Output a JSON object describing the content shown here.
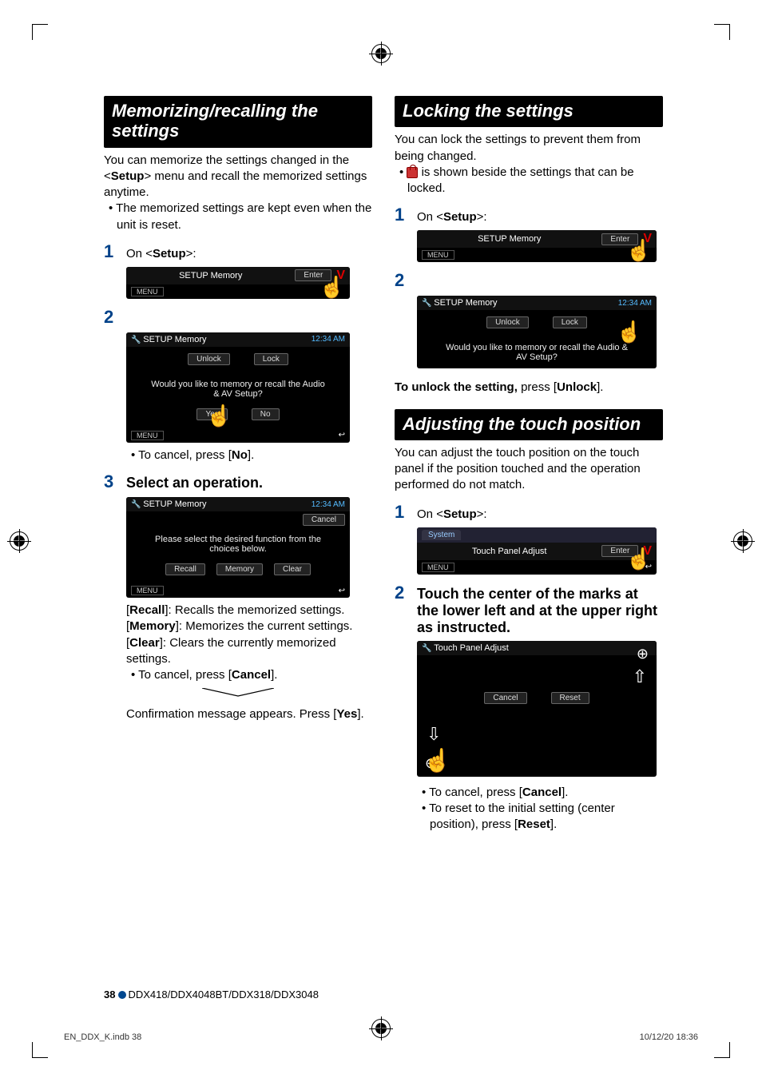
{
  "left": {
    "heading": "Memorizing/recalling the settings",
    "intro_a": "You can memorize the settings changed in the ",
    "setup_word": "Setup",
    "intro_b": " menu and recall the memorized settings anytime.",
    "bullet": "The memorized settings are kept even when the unit is reset.",
    "colon": ":",
    "period": ".",
    "step1": {
      "num": "1",
      "text_a": "On "
    },
    "step2": {
      "num": "2"
    },
    "step3": {
      "num": "3",
      "text": "Select an operation."
    },
    "cancel_a": "To cancel, press ",
    "recall_desc": ": Recalls the memorized settings.",
    "memory_desc": ": Memorizes the current settings.",
    "clear_desc": ": Clears the currently memorized settings.",
    "confirm_a": "Confirmation message appears. Press "
  },
  "right": {
    "lock_heading": "Locking the settings",
    "lock_intro": "You can lock the settings to prevent them from being changed.",
    "lock_bullet": " is shown beside the settings that can be locked.",
    "step1": {
      "num": "1"
    },
    "step2": {
      "num": "2"
    },
    "unlock_label": "To unlock the setting,",
    "unlock_text_a": " press ",
    "touch_heading": "Adjusting the touch position",
    "touch_intro": "You can adjust the touch position on the touch panel if the position touched and the operation performed do not match.",
    "tstep1": {
      "num": "1"
    },
    "tstep2": {
      "num": "2",
      "text": "Touch the center of the marks at the lower left and at the upper right as instructed."
    },
    "reset_a": "To reset to the initial setting (center position), press "
  },
  "screens": {
    "setup_memory": "SETUP Memory",
    "enter": "Enter",
    "menu": "MENU",
    "clock": "12:34 AM",
    "unlock": "Unlock",
    "lock": "Lock",
    "prompt": "Would you like to memory or recall the Audio & AV Setup?",
    "yes": "Yes",
    "no": "No",
    "cancel": "Cancel",
    "select_prompt": "Please select the desired function from the choices below.",
    "recall": "Recall",
    "memory": "Memory",
    "clear": "Clear",
    "system": "System",
    "touch_panel_adjust": "Touch Panel Adjust",
    "reset": "Reset"
  },
  "footer": {
    "page": "38",
    "models": "DDX418/DDX4048BT/DDX318/DDX3048",
    "file": "EN_DDX_K.indb   38",
    "timestamp": "10/12/20   18:36"
  }
}
